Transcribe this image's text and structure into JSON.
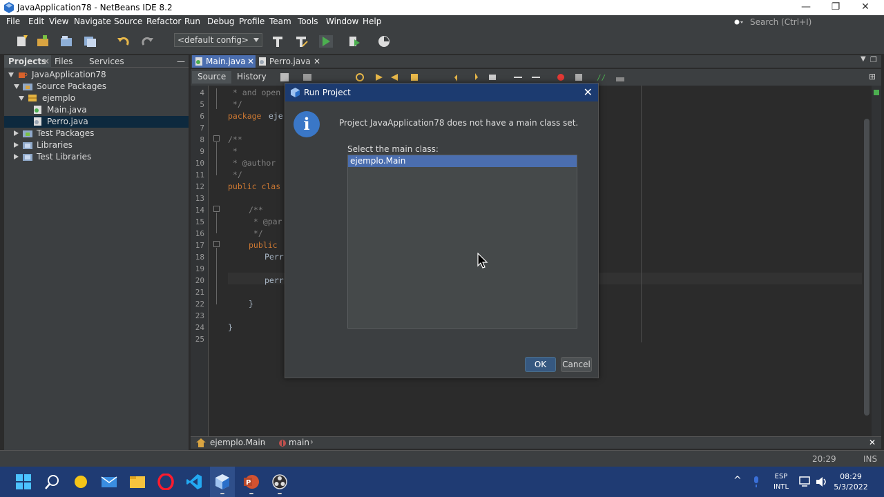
{
  "window": {
    "title": "JavaApplication78 - NetBeans IDE 8.2",
    "minimize": "—",
    "maximize": "❐",
    "close": "✕"
  },
  "menu": [
    "File",
    "Edit",
    "View",
    "Navigate",
    "Source",
    "Refactor",
    "Run",
    "Debug",
    "Profile",
    "Team",
    "Tools",
    "Window",
    "Help"
  ],
  "search": {
    "placeholder": "Search (Ctrl+I)"
  },
  "toolbar": {
    "config": "<default config>"
  },
  "left_panel": {
    "tabs": [
      "Projects",
      "Files",
      "Services"
    ],
    "tree": [
      {
        "label": "JavaApplication78"
      },
      {
        "label": "Source Packages"
      },
      {
        "label": "ejemplo"
      },
      {
        "label": "Main.java"
      },
      {
        "label": "Perro.java"
      },
      {
        "label": "Test Packages"
      },
      {
        "label": "Libraries"
      },
      {
        "label": "Test Libraries"
      }
    ]
  },
  "editor": {
    "tabs": [
      "Main.java",
      "Perro.java"
    ],
    "view_tabs": [
      "Source",
      "History"
    ],
    "line_numbers": [
      "4",
      "5",
      "6",
      "7",
      "8",
      "9",
      "10",
      "11",
      "12",
      "13",
      "14",
      "15",
      "16",
      "17",
      "18",
      "19",
      "20",
      "21",
      "22",
      "23",
      "24",
      "25"
    ],
    "code": {
      "l4": " * and open",
      "l5": " */",
      "l6_kw": "package",
      "l6_rest": " eje",
      "l8": "/**",
      "l9": " *",
      "l10": " * @author",
      "l11": " */",
      "l12_kw": "public clas",
      "l14": "/**",
      "l15": " * @par",
      "l16": " */",
      "l17_kw": "public",
      "l18": "Perr",
      "l20": "perr",
      "l22": "}",
      "l24": "}"
    }
  },
  "breadcrumb": {
    "class": "ejemplo.Main",
    "method": "main"
  },
  "statusbar": {
    "position": "20:29",
    "mode": "INS"
  },
  "dialog": {
    "title": "Run Project",
    "info_glyph": "i",
    "message": "Project JavaApplication78 does not have a main class set.",
    "label": "Select the main class:",
    "options": [
      "ejemplo.Main"
    ],
    "ok": "OK",
    "cancel": "Cancel"
  },
  "taskbar": {
    "lang_top": "ESP",
    "lang_bottom": "INTL",
    "time": "08:29",
    "date": "5/3/2022"
  }
}
